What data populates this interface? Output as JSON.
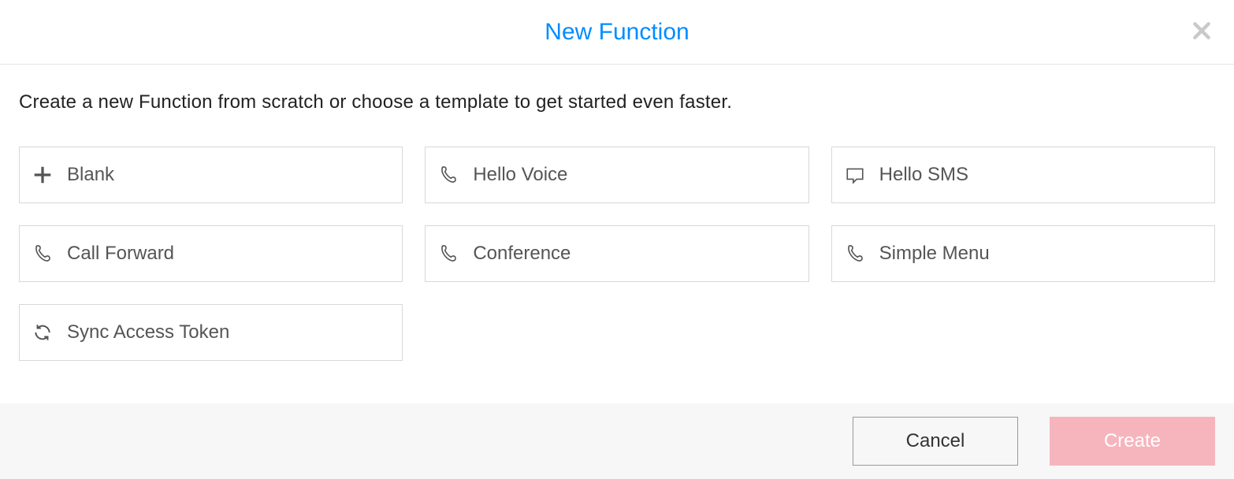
{
  "modal": {
    "title": "New Function",
    "description": "Create a new Function from scratch or choose a template to get started even faster."
  },
  "templates": [
    {
      "icon": "plus",
      "label": "Blank"
    },
    {
      "icon": "phone",
      "label": "Hello Voice"
    },
    {
      "icon": "chat",
      "label": "Hello SMS"
    },
    {
      "icon": "phone",
      "label": "Call Forward"
    },
    {
      "icon": "phone",
      "label": "Conference"
    },
    {
      "icon": "phone",
      "label": "Simple Menu"
    },
    {
      "icon": "sync",
      "label": "Sync Access Token"
    }
  ],
  "footer": {
    "cancel_label": "Cancel",
    "create_label": "Create"
  }
}
